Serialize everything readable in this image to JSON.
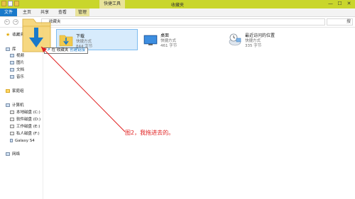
{
  "titlebar": {
    "title": "收藏夹",
    "context_tab": "快捷工具",
    "controls": [
      "—",
      "☐",
      "✕"
    ]
  },
  "ribbon": {
    "tabs": [
      "文件",
      "主页",
      "共享",
      "查看",
      "管理"
    ]
  },
  "address": {
    "path": "收藏夹",
    "search_label": "搜"
  },
  "sidebar": {
    "favorites": "收藏夹",
    "library": "库",
    "videos": "视频",
    "pictures": "图片",
    "documents": "文档",
    "music": "音乐",
    "homegroup": "家庭组",
    "computer": "计算机",
    "drives": [
      "本地磁盘 (C:)",
      "软件磁盘 (D:)",
      "工作磁盘 (E:)",
      "私人磁盘 (F:)",
      "Galaxy S4"
    ],
    "network": "网络"
  },
  "items": [
    {
      "name": "下载",
      "type": "快捷方式",
      "size": "844 字节",
      "icon": "download-folder-icon"
    },
    {
      "name": "桌面",
      "type": "快捷方式",
      "size": "461 字节",
      "icon": "desktop-icon"
    },
    {
      "name": "最近访问的位置",
      "type": "快捷方式",
      "size": "335 字节",
      "icon": "recent-places-icon"
    }
  ],
  "tooltip": {
    "prefix": "在 收藏夹",
    "action": "创建链接"
  },
  "annotation": "图2，我拖进去的。",
  "colors": {
    "titlebar": "#c9d62c",
    "file_tab": "#1979ca",
    "selection": "#d7ebfc",
    "annotation": "#e02020"
  }
}
